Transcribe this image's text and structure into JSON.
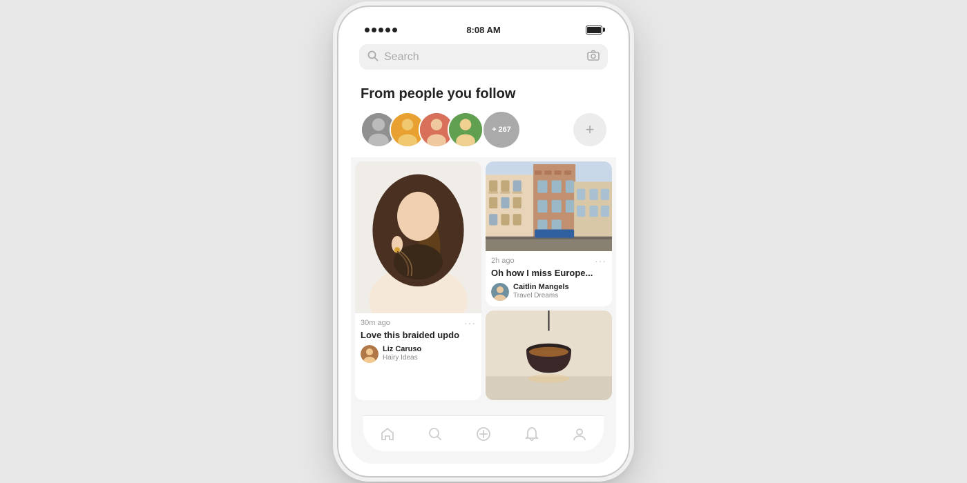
{
  "statusBar": {
    "time": "8:08 AM",
    "signalDots": 5,
    "batteryFull": true
  },
  "searchBar": {
    "placeholder": "Search"
  },
  "section": {
    "title": "From people you follow"
  },
  "followers": {
    "more_count": "+ 267",
    "add_label": "+"
  },
  "pins": [
    {
      "id": "pin-1",
      "type": "hair",
      "time_ago": "30m ago",
      "title": "Love this braided updo",
      "user_name": "Liz Caruso",
      "user_board": "Hairy Ideas",
      "user_color": "#b08060"
    },
    {
      "id": "pin-2",
      "type": "europe",
      "time_ago": "2h ago",
      "title": "Oh how I miss Europe...",
      "user_name": "Caitlin Mangels",
      "user_board": "Travel Dreams",
      "user_color": "#7090a0"
    },
    {
      "id": "pin-3",
      "type": "lamp",
      "time_ago": "",
      "title": "",
      "user_name": "",
      "user_board": "",
      "user_color": "#888"
    }
  ],
  "avatars": [
    {
      "color": "#888888",
      "initials": ""
    },
    {
      "color": "#e0a050",
      "initials": ""
    },
    {
      "color": "#d06050",
      "initials": ""
    },
    {
      "color": "#80a060",
      "initials": ""
    }
  ],
  "nav": {
    "items": [
      {
        "icon": "⊞",
        "label": "home",
        "active": true
      },
      {
        "icon": "🔍",
        "label": "search",
        "active": false
      },
      {
        "icon": "＋",
        "label": "add",
        "active": false
      },
      {
        "icon": "🔔",
        "label": "notifications",
        "active": false
      },
      {
        "icon": "◉",
        "label": "profile",
        "active": false
      }
    ]
  }
}
